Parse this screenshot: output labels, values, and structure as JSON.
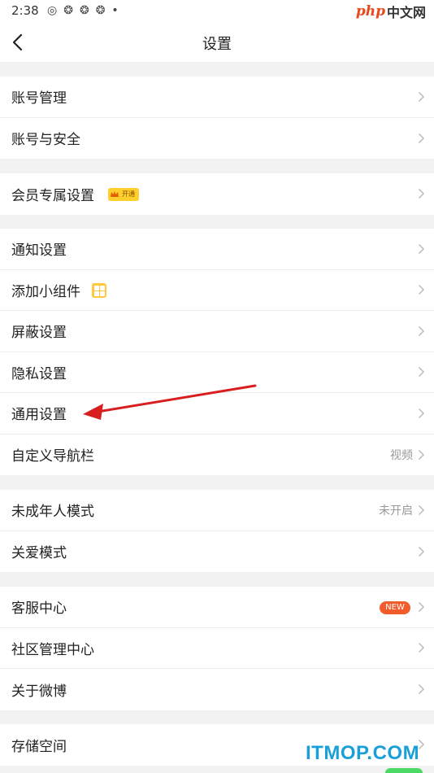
{
  "status_bar": {
    "time": "2:38",
    "icons": [
      "weibo-icon",
      "app-icon",
      "app-icon",
      "app-icon",
      "dot-icon"
    ],
    "icon_glyphs": [
      "◎",
      "❂",
      "❂",
      "❂",
      "•"
    ]
  },
  "watermark_top": {
    "php": "php",
    "cn": "中文网"
  },
  "nav": {
    "title": "设置"
  },
  "groups": {
    "account": [
      "账号管理",
      "账号与安全"
    ],
    "vip": {
      "label": "会员专属设置",
      "badge": "开通"
    },
    "main": {
      "notify": "通知设置",
      "widget": "添加小组件",
      "block": "屏蔽设置",
      "privacy": "隐私设置",
      "general": "通用设置",
      "custom_nav": "自定义导航栏",
      "custom_nav_value": "视频"
    },
    "minor": {
      "youth": "未成年人模式",
      "youth_value": "未开启",
      "care": "关爱模式"
    },
    "service": {
      "support": "客服中心",
      "support_badge": "NEW",
      "community": "社区管理中心",
      "about": "关于微博"
    },
    "storage": {
      "label": "存储空间"
    }
  },
  "watermark_bottom": "ITMOP.COM",
  "colors": {
    "accent_red": "#e02020",
    "new_badge": "#f25b2a",
    "vip_gold": "#ffcf2e",
    "watermark_blue": "#1aa0d8"
  }
}
